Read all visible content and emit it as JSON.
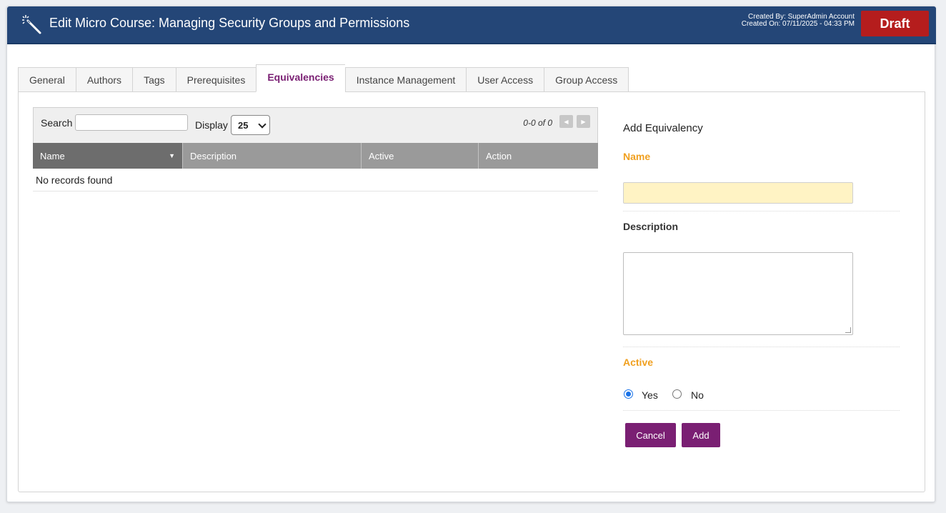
{
  "header": {
    "title": "Edit Micro Course: Managing Security Groups and Permissions",
    "created_by": "Created By: SuperAdmin Account",
    "created_on": "Created On: 07/11/2025 - 04:33 PM",
    "status_badge": "Draft",
    "colors": {
      "bar": "#244677",
      "badge": "#b51d1d"
    }
  },
  "tabs": [
    {
      "label": "General"
    },
    {
      "label": "Authors"
    },
    {
      "label": "Tags"
    },
    {
      "label": "Prerequisites"
    },
    {
      "label": "Equivalencies",
      "active": true
    },
    {
      "label": "Instance Management"
    },
    {
      "label": "User Access"
    },
    {
      "label": "Group Access"
    }
  ],
  "table": {
    "search_label": "Search",
    "search_value": "",
    "display_label": "Display",
    "display_value": "25",
    "pager_text": "0-0 of 0",
    "columns": [
      "Name",
      "Description",
      "Active",
      "Action"
    ],
    "sorted_column": "Name",
    "empty_message": "No records found"
  },
  "form": {
    "title": "Add Equivalency",
    "name_label": "Name",
    "name_value": "",
    "description_label": "Description",
    "description_value": "",
    "active_label": "Active",
    "active_options": [
      "Yes",
      "No"
    ],
    "active_selected": "Yes",
    "cancel_label": "Cancel",
    "add_label": "Add",
    "colors": {
      "required_label": "#f0a020",
      "button": "#7a1f73",
      "name_field": "#fff3c4"
    }
  }
}
